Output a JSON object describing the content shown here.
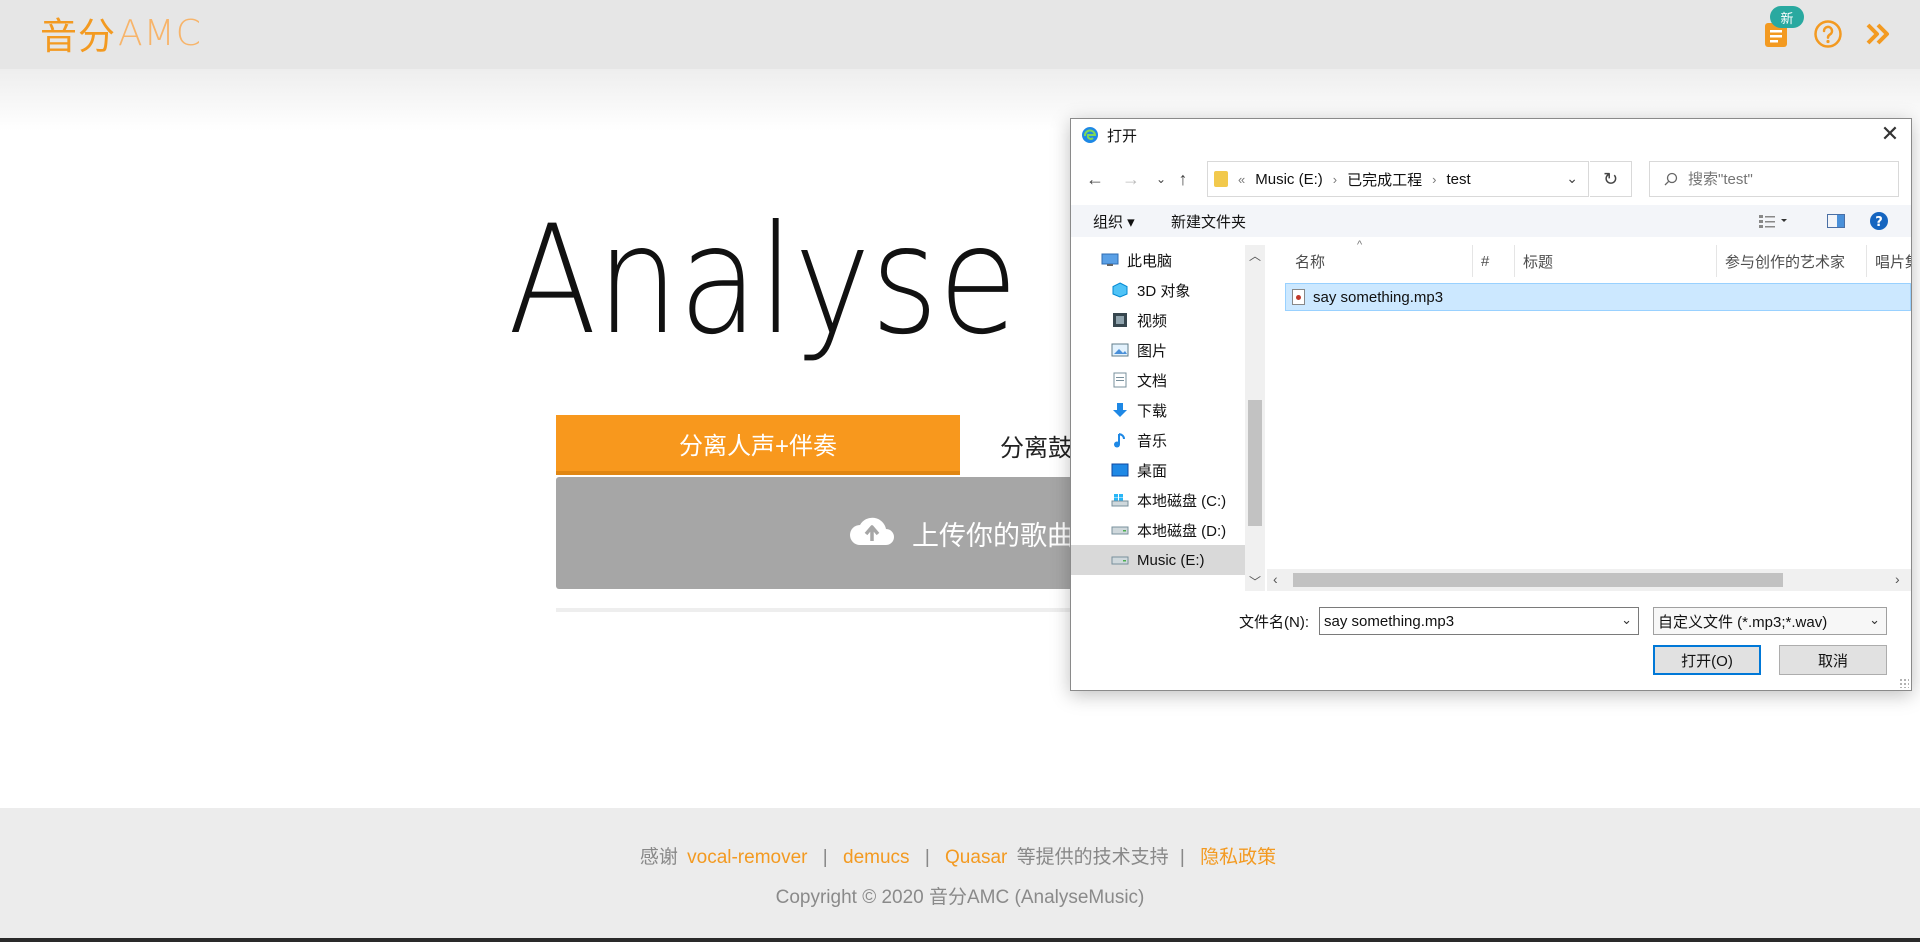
{
  "app": {
    "logo_cn": "音分",
    "logo_en": "AMC",
    "news_badge": "新",
    "accent": "#f8981d",
    "hero_text": "Analyse",
    "tabs": [
      {
        "label": "分离人声+伴奏",
        "active": true
      },
      {
        "label": "分离鼓",
        "active": false
      }
    ],
    "upload_label": "上传你的歌曲"
  },
  "footer": {
    "thanks": "感谢",
    "links": [
      "vocal-remover",
      "demucs",
      "Quasar"
    ],
    "support_text": "等提供的技术支持",
    "privacy": "隐私政策",
    "copyright": "Copyright © 2020 音分AMC (AnalyseMusic)"
  },
  "dialog": {
    "title": "打开",
    "close": "✕",
    "breadcrumb": [
      "Music (E:)",
      "已完成工程",
      "test"
    ],
    "breadcrumb_prefix": "«",
    "search_placeholder": "搜索\"test\"",
    "toolbar": {
      "organize": "组织 ▾",
      "new_folder": "新建文件夹"
    },
    "nav_items": [
      {
        "label": "此电脑",
        "icon": "computer-icon"
      },
      {
        "label": "3D 对象",
        "icon": "cube-icon"
      },
      {
        "label": "视频",
        "icon": "video-icon"
      },
      {
        "label": "图片",
        "icon": "picture-icon"
      },
      {
        "label": "文档",
        "icon": "document-icon"
      },
      {
        "label": "下载",
        "icon": "download-icon"
      },
      {
        "label": "音乐",
        "icon": "music-icon"
      },
      {
        "label": "桌面",
        "icon": "desktop-icon"
      },
      {
        "label": "本地磁盘 (C:)",
        "icon": "windows-drive-icon"
      },
      {
        "label": "本地磁盘 (D:)",
        "icon": "drive-icon"
      },
      {
        "label": "Music (E:)",
        "icon": "drive-icon",
        "selected": true
      }
    ],
    "columns": [
      "名称",
      "#",
      "标题",
      "参与创作的艺术家",
      "唱片集"
    ],
    "files": [
      {
        "name": "say something.mp3",
        "selected": true
      }
    ],
    "filename_label": "文件名(N):",
    "filename_value": "say something.mp3",
    "filetype_value": "自定义文件 (*.mp3;*.wav)",
    "open_button": "打开(O)",
    "cancel_button": "取消"
  }
}
